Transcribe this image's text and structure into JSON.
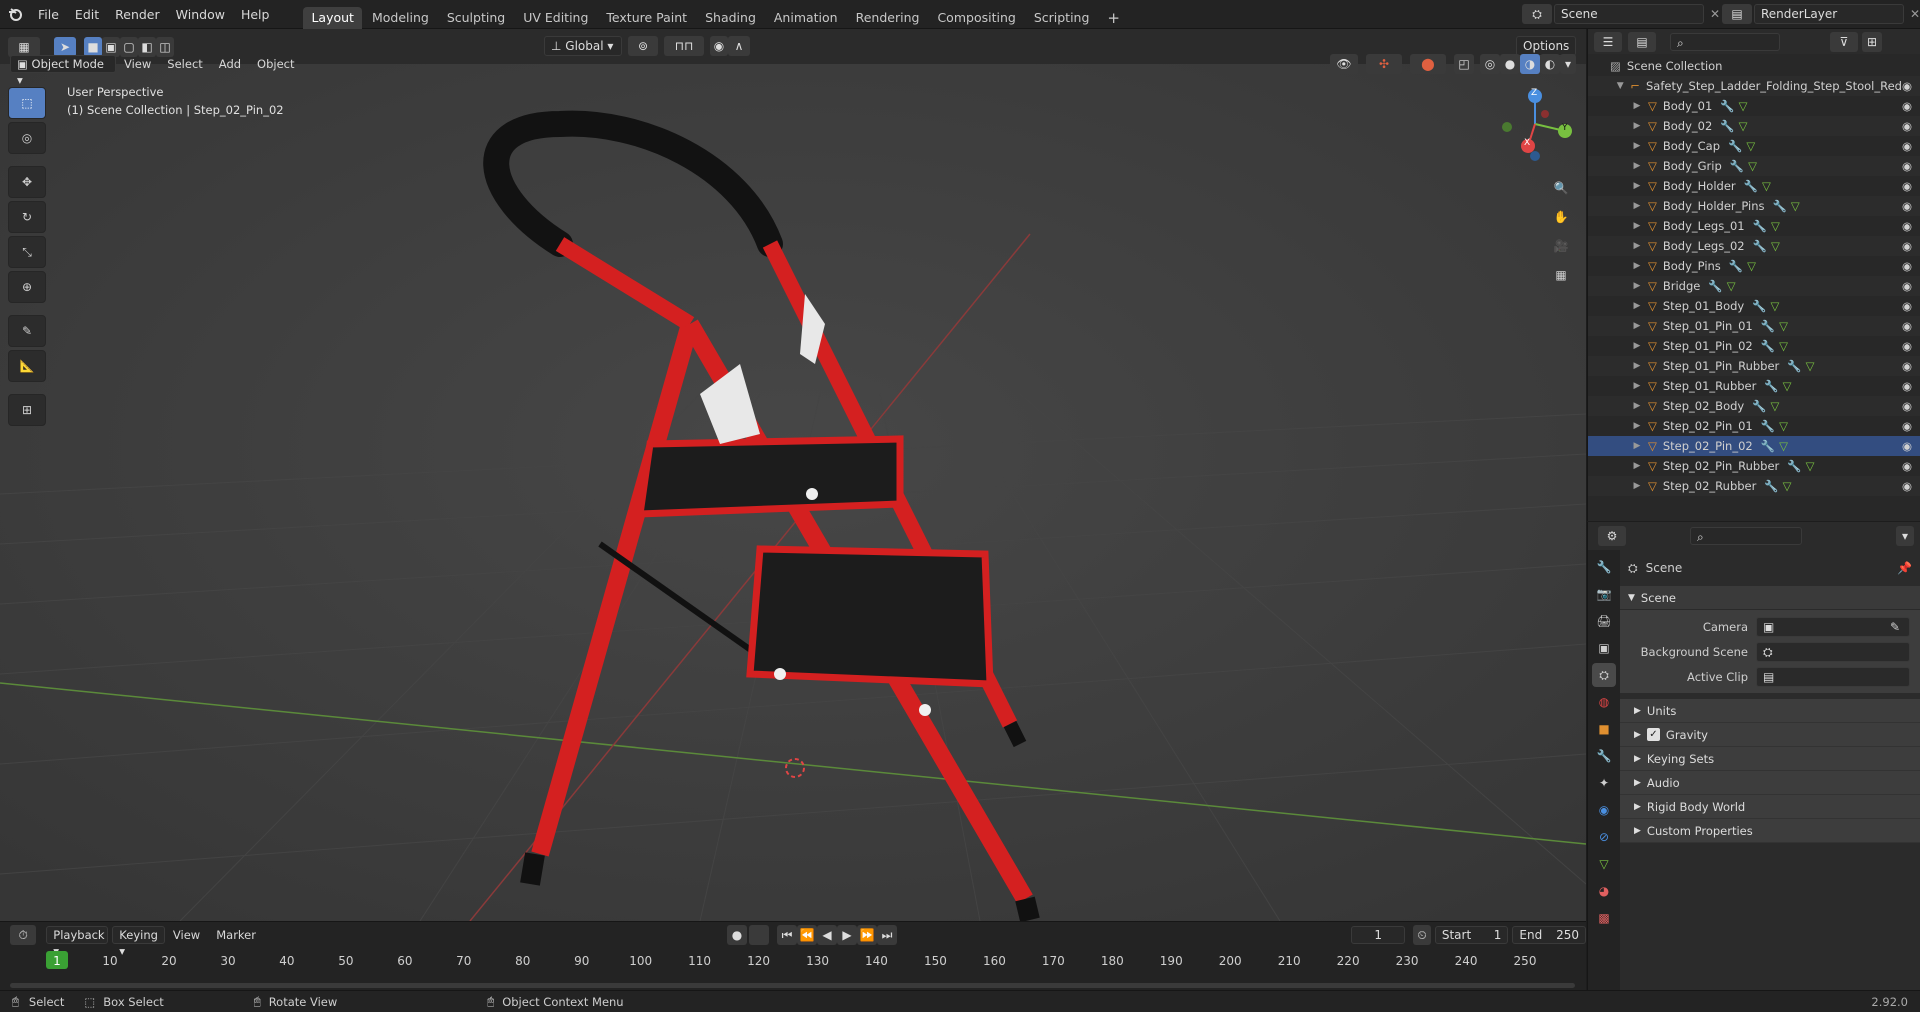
{
  "topbar": {
    "menus": [
      "File",
      "Edit",
      "Render",
      "Window",
      "Help"
    ],
    "workspaces": [
      "Layout",
      "Modeling",
      "Sculpting",
      "UV Editing",
      "Texture Paint",
      "Shading",
      "Animation",
      "Rendering",
      "Compositing",
      "Scripting"
    ],
    "active_workspace": "Layout",
    "add_tab": "+",
    "scene_name": "Scene",
    "render_layer": "RenderLayer"
  },
  "viewport_header": {
    "mode": "Object Mode",
    "menus": [
      "View",
      "Select",
      "Add",
      "Object"
    ],
    "transform_orientation": "Global",
    "options": "Options"
  },
  "viewport": {
    "perspective": "User Perspective",
    "collection_info": "(1) Scene Collection | Step_02_Pin_02",
    "gizmo": {
      "z": "Z",
      "y": "Y",
      "x": "X"
    }
  },
  "outliner": {
    "root": "Scene Collection",
    "collection": "Safety_Step_Ladder_Folding_Step_Stool_Red",
    "objects": [
      "Body_01",
      "Body_02",
      "Body_Cap",
      "Body_Grip",
      "Body_Holder",
      "Body_Holder_Pins",
      "Body_Legs_01",
      "Body_Legs_02",
      "Body_Pins",
      "Bridge",
      "Step_01_Body",
      "Step_01_Pin_01",
      "Step_01_Pin_02",
      "Step_01_Pin_Rubber",
      "Step_01_Rubber",
      "Step_02_Body",
      "Step_02_Pin_01",
      "Step_02_Pin_02",
      "Step_02_Pin_Rubber",
      "Step_02_Rubber"
    ],
    "selected": "Step_02_Pin_02"
  },
  "properties": {
    "context": "Scene",
    "panel": "Scene",
    "fields": {
      "camera": "Camera",
      "background_scene": "Background Scene",
      "active_clip": "Active Clip"
    },
    "subpanels": [
      "Units",
      "Gravity",
      "Keying Sets",
      "Audio",
      "Rigid Body World",
      "Custom Properties"
    ],
    "gravity_checked": true
  },
  "timeline": {
    "menus": [
      "Playback",
      "Keying",
      "View",
      "Marker"
    ],
    "current_frame": "1",
    "start_label": "Start",
    "start": "1",
    "end_label": "End",
    "end": "250",
    "ticks": [
      "1",
      "10",
      "20",
      "30",
      "40",
      "50",
      "60",
      "70",
      "80",
      "90",
      "100",
      "110",
      "120",
      "130",
      "140",
      "150",
      "160",
      "170",
      "180",
      "190",
      "200",
      "210",
      "220",
      "230",
      "240",
      "250"
    ]
  },
  "statusbar": {
    "select": "Select",
    "box_select": "Box Select",
    "rotate_view": "Rotate View",
    "context_menu": "Object Context Menu",
    "version": "2.92.0"
  },
  "colors": {
    "ladder_red": "#d42020",
    "selected_blue": "#5680c2",
    "axis_x": "#e04545",
    "axis_y": "#78c040",
    "axis_z": "#4a8fe0",
    "frame_green": "#3aa034"
  }
}
